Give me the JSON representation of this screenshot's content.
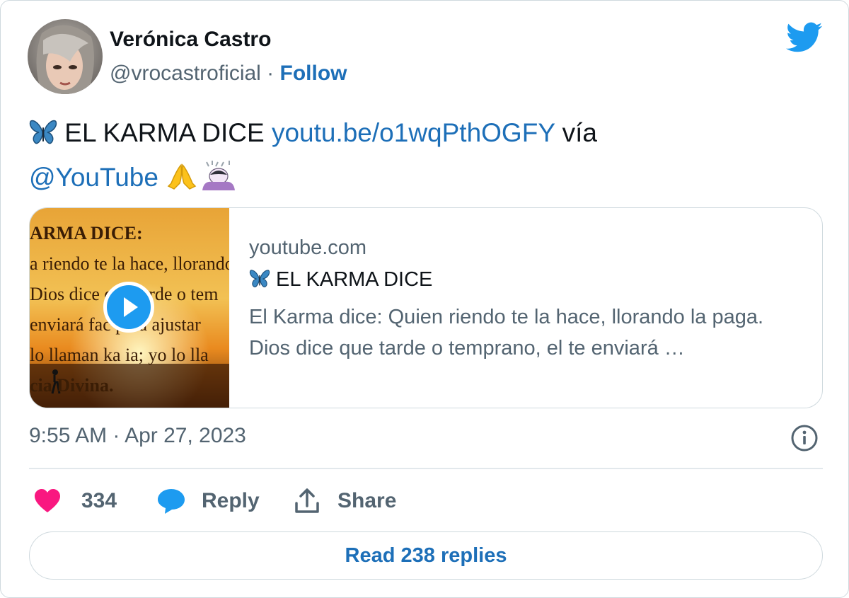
{
  "author": {
    "name": "Verónica Castro",
    "handle": "@vrocastroficial",
    "separator": " · ",
    "follow_label": "Follow"
  },
  "tweet": {
    "text_main": " EL KARMA DICE ",
    "link": "youtu.be/o1wqPthOGFY",
    "via_text": " vía",
    "mention": "@YouTube",
    "emojis": [
      "butterfly",
      "folded-hands",
      "person-bowing"
    ]
  },
  "card": {
    "domain": "youtube.com",
    "title": " EL KARMA DICE",
    "description": "El Karma dice: Quien riendo te la hace, llorando la paga. Dios dice que tarde o temprano, el te enviará …",
    "thumbnail_lines": [
      "ARMA DICE:",
      "a riendo te la hace, llorando",
      " Dios dice que tarde o tem",
      "enviará fac     para ajustar",
      "lo llaman ka     ia; yo lo lla",
      "cia Divina."
    ]
  },
  "meta": {
    "timestamp": "9:55 AM · Apr 27, 2023"
  },
  "actions": {
    "like_count": "334",
    "reply_label": "Reply",
    "share_label": "Share"
  },
  "read_replies_label": "Read 238 replies",
  "colors": {
    "link": "#1d6fb8",
    "twitter_blue": "#1d9bf0",
    "heart": "#f91880",
    "muted": "#536471"
  }
}
